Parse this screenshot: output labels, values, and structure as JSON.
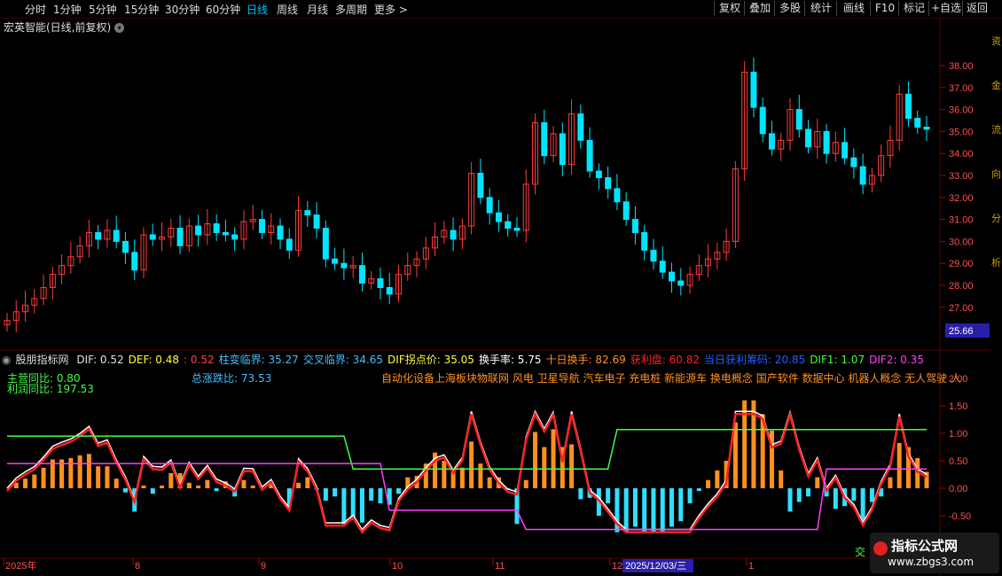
{
  "toolbar": {
    "periods": [
      "分时",
      "1分钟",
      "5分钟",
      "15分钟",
      "30分钟",
      "60分钟",
      "日线",
      "周线",
      "月线",
      "多周期",
      "更多 >"
    ],
    "active_period": "日线",
    "right_buttons": [
      "复权",
      "叠加",
      "多股",
      "统计",
      "画线",
      "F10",
      "标记",
      "+自选",
      "返回"
    ]
  },
  "stock": {
    "title": "宏英智能(日线,前复权)"
  },
  "price_axis": {
    "ticks": [
      "38.00",
      "37.00",
      "36.00",
      "35.00",
      "34.00",
      "33.00",
      "32.00",
      "31.00",
      "30.00",
      "29.00",
      "28.00",
      "27.00"
    ],
    "current": "25.66"
  },
  "indicator": {
    "name": "股朋指标网",
    "values": [
      {
        "text": "DIF: 0.52",
        "color": "#e0e0e0"
      },
      {
        "text": "DEF: 0.48",
        "color": "#ffff40"
      },
      {
        "text": ": 0.52",
        "color": "#ff4040"
      },
      {
        "text": "柱变临界: 35.27",
        "color": "#40c0ff"
      },
      {
        "text": "交叉临界: 34.65",
        "color": "#40c0ff"
      },
      {
        "text": "DIF拐点价: 35.05",
        "color": "#ffff40"
      },
      {
        "text": "换手率: 5.75",
        "color": "#ffffff"
      },
      {
        "text": "十日换手: 82.69",
        "color": "#ff9020"
      },
      {
        "text": "获利盘: 60.82",
        "color": "#ff2020"
      },
      {
        "text": "当日获利筹码: 20.85",
        "color": "#2060ff"
      },
      {
        "text": "DIF1: 1.07",
        "color": "#40ff40"
      },
      {
        "text": "DIF2: 0.35",
        "color": "#ff40ff"
      }
    ],
    "main_yoy_label": "主营同比: 0.80",
    "profit_yoy_label": "利润同比: 197.53",
    "rise_fall_label": "总涨跌比: 73.53",
    "concepts": "自动化设备上海板块物联网 风电 卫星导航 汽车电子 充电桩 新能源车 换电概念 国产软件 数据中心 机器人概念 无人驾驶 人",
    "axis_ticks": [
      "2.00",
      "1.50",
      "1.00",
      "0.50",
      "0.00",
      "-0.50"
    ],
    "cross_label": "交"
  },
  "time_axis": {
    "labels": [
      "2025年",
      "8",
      "9",
      "10",
      "11",
      "12",
      "1"
    ],
    "cursor": "2025/12/03/三"
  },
  "right_strip_chars": [
    "资",
    "金",
    "流",
    "向",
    "分",
    "析"
  ],
  "watermark": {
    "line1": "指标公式网",
    "line2": "www.zbgs3.com"
  },
  "colors": {
    "up": "#ff3b3b",
    "down": "#00e5ff",
    "grid": "#5a0000",
    "bull": "#ff9020",
    "bear": "#30e0ff"
  },
  "chart_data": {
    "type": "candlestick",
    "closes": [
      26.4,
      26.8,
      27.1,
      27.4,
      27.9,
      28.5,
      28.9,
      29.3,
      29.8,
      30.4,
      30.1,
      30.5,
      30.0,
      29.5,
      28.7,
      30.3,
      30.1,
      30.2,
      30.6,
      29.8,
      30.7,
      30.3,
      30.8,
      30.4,
      30.3,
      30.1,
      30.9,
      31.0,
      30.4,
      30.7,
      30.1,
      29.6,
      31.4,
      31.2,
      30.6,
      29.2,
      29.0,
      28.8,
      28.9,
      28.1,
      28.3,
      27.9,
      27.6,
      28.5,
      28.9,
      29.2,
      29.7,
      30.2,
      30.5,
      30.1,
      30.7,
      33.1,
      32.0,
      31.3,
      30.9,
      30.6,
      30.5,
      32.6,
      35.4,
      33.9,
      34.9,
      33.5,
      35.8,
      34.6,
      33.2,
      32.9,
      32.4,
      31.8,
      31.0,
      30.4,
      29.6,
      29.1,
      28.6,
      28.2,
      28.0,
      28.5,
      28.9,
      29.2,
      29.5,
      30.0,
      33.3,
      37.7,
      36.1,
      34.9,
      34.2,
      34.6,
      36.0,
      35.1,
      34.3,
      35.0,
      34.0,
      34.5,
      33.8,
      33.4,
      32.6,
      33.0,
      33.9,
      34.6,
      36.7,
      35.6,
      35.2,
      35.1
    ]
  }
}
